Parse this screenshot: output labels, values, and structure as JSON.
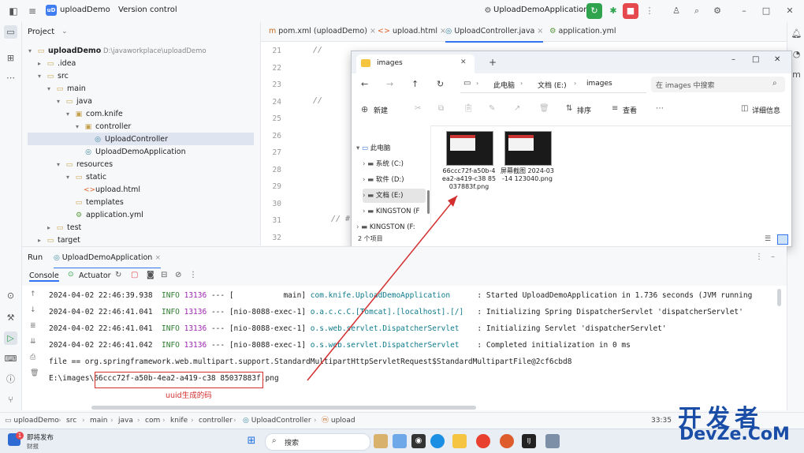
{
  "titlebar": {
    "project_badge": "uD",
    "project_name": "uploadDemo",
    "vcs": "Version control",
    "run_config": "UploadDemoApplication"
  },
  "project_panel": {
    "title": "Project",
    "tree": [
      {
        "label": "uploadDemo",
        "suffix": "D:\\javaworkplace\\uploadDemo",
        "icon": "folder",
        "indent": 0,
        "arrow": "▾"
      },
      {
        "label": ".idea",
        "suffix": "",
        "icon": "folder",
        "indent": 1,
        "arrow": "▸"
      },
      {
        "label": "src",
        "suffix": "",
        "icon": "folder",
        "indent": 1,
        "arrow": "▾"
      },
      {
        "label": "main",
        "suffix": "",
        "icon": "folder",
        "indent": 2,
        "arrow": "▾"
      },
      {
        "label": "java",
        "suffix": "",
        "icon": "folder",
        "indent": 3,
        "arrow": "▾"
      },
      {
        "label": "com.knife",
        "suffix": "",
        "icon": "package",
        "indent": 4,
        "arrow": "▾"
      },
      {
        "label": "controller",
        "suffix": "",
        "icon": "package",
        "indent": 5,
        "arrow": "▾"
      },
      {
        "label": "UploadController",
        "suffix": "",
        "icon": "class",
        "indent": 6,
        "arrow": ""
      },
      {
        "label": "UploadDemoApplication",
        "suffix": "",
        "icon": "class",
        "indent": 5,
        "arrow": ""
      },
      {
        "label": "resources",
        "suffix": "",
        "icon": "folder",
        "indent": 3,
        "arrow": "▾"
      },
      {
        "label": "static",
        "suffix": "",
        "icon": "folder",
        "indent": 4,
        "arrow": "▾"
      },
      {
        "label": "upload.html",
        "suffix": "",
        "icon": "html",
        "indent": 5,
        "arrow": ""
      },
      {
        "label": "templates",
        "suffix": "",
        "icon": "folder",
        "indent": 4,
        "arrow": ""
      },
      {
        "label": "application.yml",
        "suffix": "",
        "icon": "yml",
        "indent": 4,
        "arrow": ""
      },
      {
        "label": "test",
        "suffix": "",
        "icon": "folder",
        "indent": 2,
        "arrow": "▸"
      },
      {
        "label": "target",
        "suffix": "",
        "icon": "folder",
        "indent": 1,
        "arrow": "▸"
      }
    ]
  },
  "editor": {
    "tabs": [
      {
        "label": "pom.xml (uploadDemo)",
        "active": false
      },
      {
        "label": "upload.html",
        "active": false
      },
      {
        "label": "UploadController.java",
        "active": true
      },
      {
        "label": "application.yml",
        "active": false
      }
    ],
    "line_numbers": [
      "21",
      "22",
      "23",
      "24",
      "25",
      "26",
      "27",
      "28",
      "29",
      "30",
      "31",
      "32"
    ],
    "comment_mark": "//",
    "comment_mark_hash": "// #"
  },
  "explorer": {
    "tab_title": "images",
    "path": [
      "此电脑",
      "文档 (E:)",
      "images"
    ],
    "search_placeholder": "在 images 中搜索",
    "new_label": "新建",
    "sort_label": "排序",
    "view_label": "查看",
    "details_label": "详细信息",
    "nav": [
      {
        "label": "此电脑",
        "arrow": "▾",
        "indent": 0,
        "selected": false
      },
      {
        "label": "系统 (C:)",
        "arrow": "›",
        "indent": 1,
        "selected": false
      },
      {
        "label": "软件 (D:)",
        "arrow": "›",
        "indent": 1,
        "selected": false
      },
      {
        "label": "文档 (E:)",
        "arrow": "›",
        "indent": 1,
        "selected": true
      },
      {
        "label": "KINGSTON (F",
        "arrow": "›",
        "indent": 1,
        "selected": false
      },
      {
        "label": "KINGSTON (F:",
        "arrow": "›",
        "indent": 0,
        "selected": false
      }
    ],
    "files": [
      {
        "name": "66ccc72f-a50b-4ea2-a419-c38 85037883f.png"
      },
      {
        "name": "屏幕截图 2024-03-14 123040.png"
      }
    ],
    "status": "2 个项目"
  },
  "run_panel": {
    "run_label": "Run",
    "run_tab": "UploadDemoApplication",
    "console_tab": "Console",
    "actuator_tab": "Actuator",
    "logs": [
      {
        "ts": "2024-04-02 22:46:39.938",
        "level": "INFO",
        "pid": "13136",
        "sep": "---",
        "thread": "[           main]",
        "cls": "com.knife.UploadDemoApplication",
        "msg": ": Started UploadDemoApplication in 1.736 seconds (JVM running"
      },
      {
        "ts": "2024-04-02 22:46:41.041",
        "level": "INFO",
        "pid": "13136",
        "sep": "---",
        "thread": "[nio-8088-exec-1]",
        "cls": "o.a.c.c.C.[Tomcat].[localhost].[/]",
        "msg": ": Initializing Spring DispatcherServlet 'dispatcherServlet'"
      },
      {
        "ts": "2024-04-02 22:46:41.041",
        "level": "INFO",
        "pid": "13136",
        "sep": "---",
        "thread": "[nio-8088-exec-1]",
        "cls": "o.s.web.servlet.DispatcherServlet",
        "msg": ": Initializing Servlet 'dispatcherServlet'"
      },
      {
        "ts": "2024-04-02 22:46:41.042",
        "level": "INFO",
        "pid": "13136",
        "sep": "---",
        "thread": "[nio-8088-exec-1]",
        "cls": "o.s.web.servlet.DispatcherServlet",
        "msg": ": Completed initialization in 0 ms"
      }
    ],
    "file_line": "file == org.springframework.web.multipart.support.StandardMultipartHttpServletRequest$StandardMultipartFile@2cf6cbd8",
    "path_prefix": "E:\\images\\",
    "uuid": "66ccc72f-a50b-4ea2-a419-c38 85037883f",
    "path_suffix": ".png",
    "annotation": "uuid生成的码"
  },
  "breadcrumb": {
    "items": [
      "uploadDemo",
      "src",
      "main",
      "java",
      "com",
      "knife",
      "controller",
      "UploadController",
      "upload"
    ],
    "position": "33:35"
  },
  "taskbar": {
    "weather_badge": "1",
    "weather_title": "即将发布",
    "weather_sub": "财报",
    "search_placeholder": "搜索"
  },
  "watermark": {
    "cn": "开发者",
    "en": "DevZe.CoM"
  },
  "colors": {
    "accent": "#3574f0",
    "annotation_red": "#d32f2f",
    "watermark_blue": "#1a4ea6"
  }
}
